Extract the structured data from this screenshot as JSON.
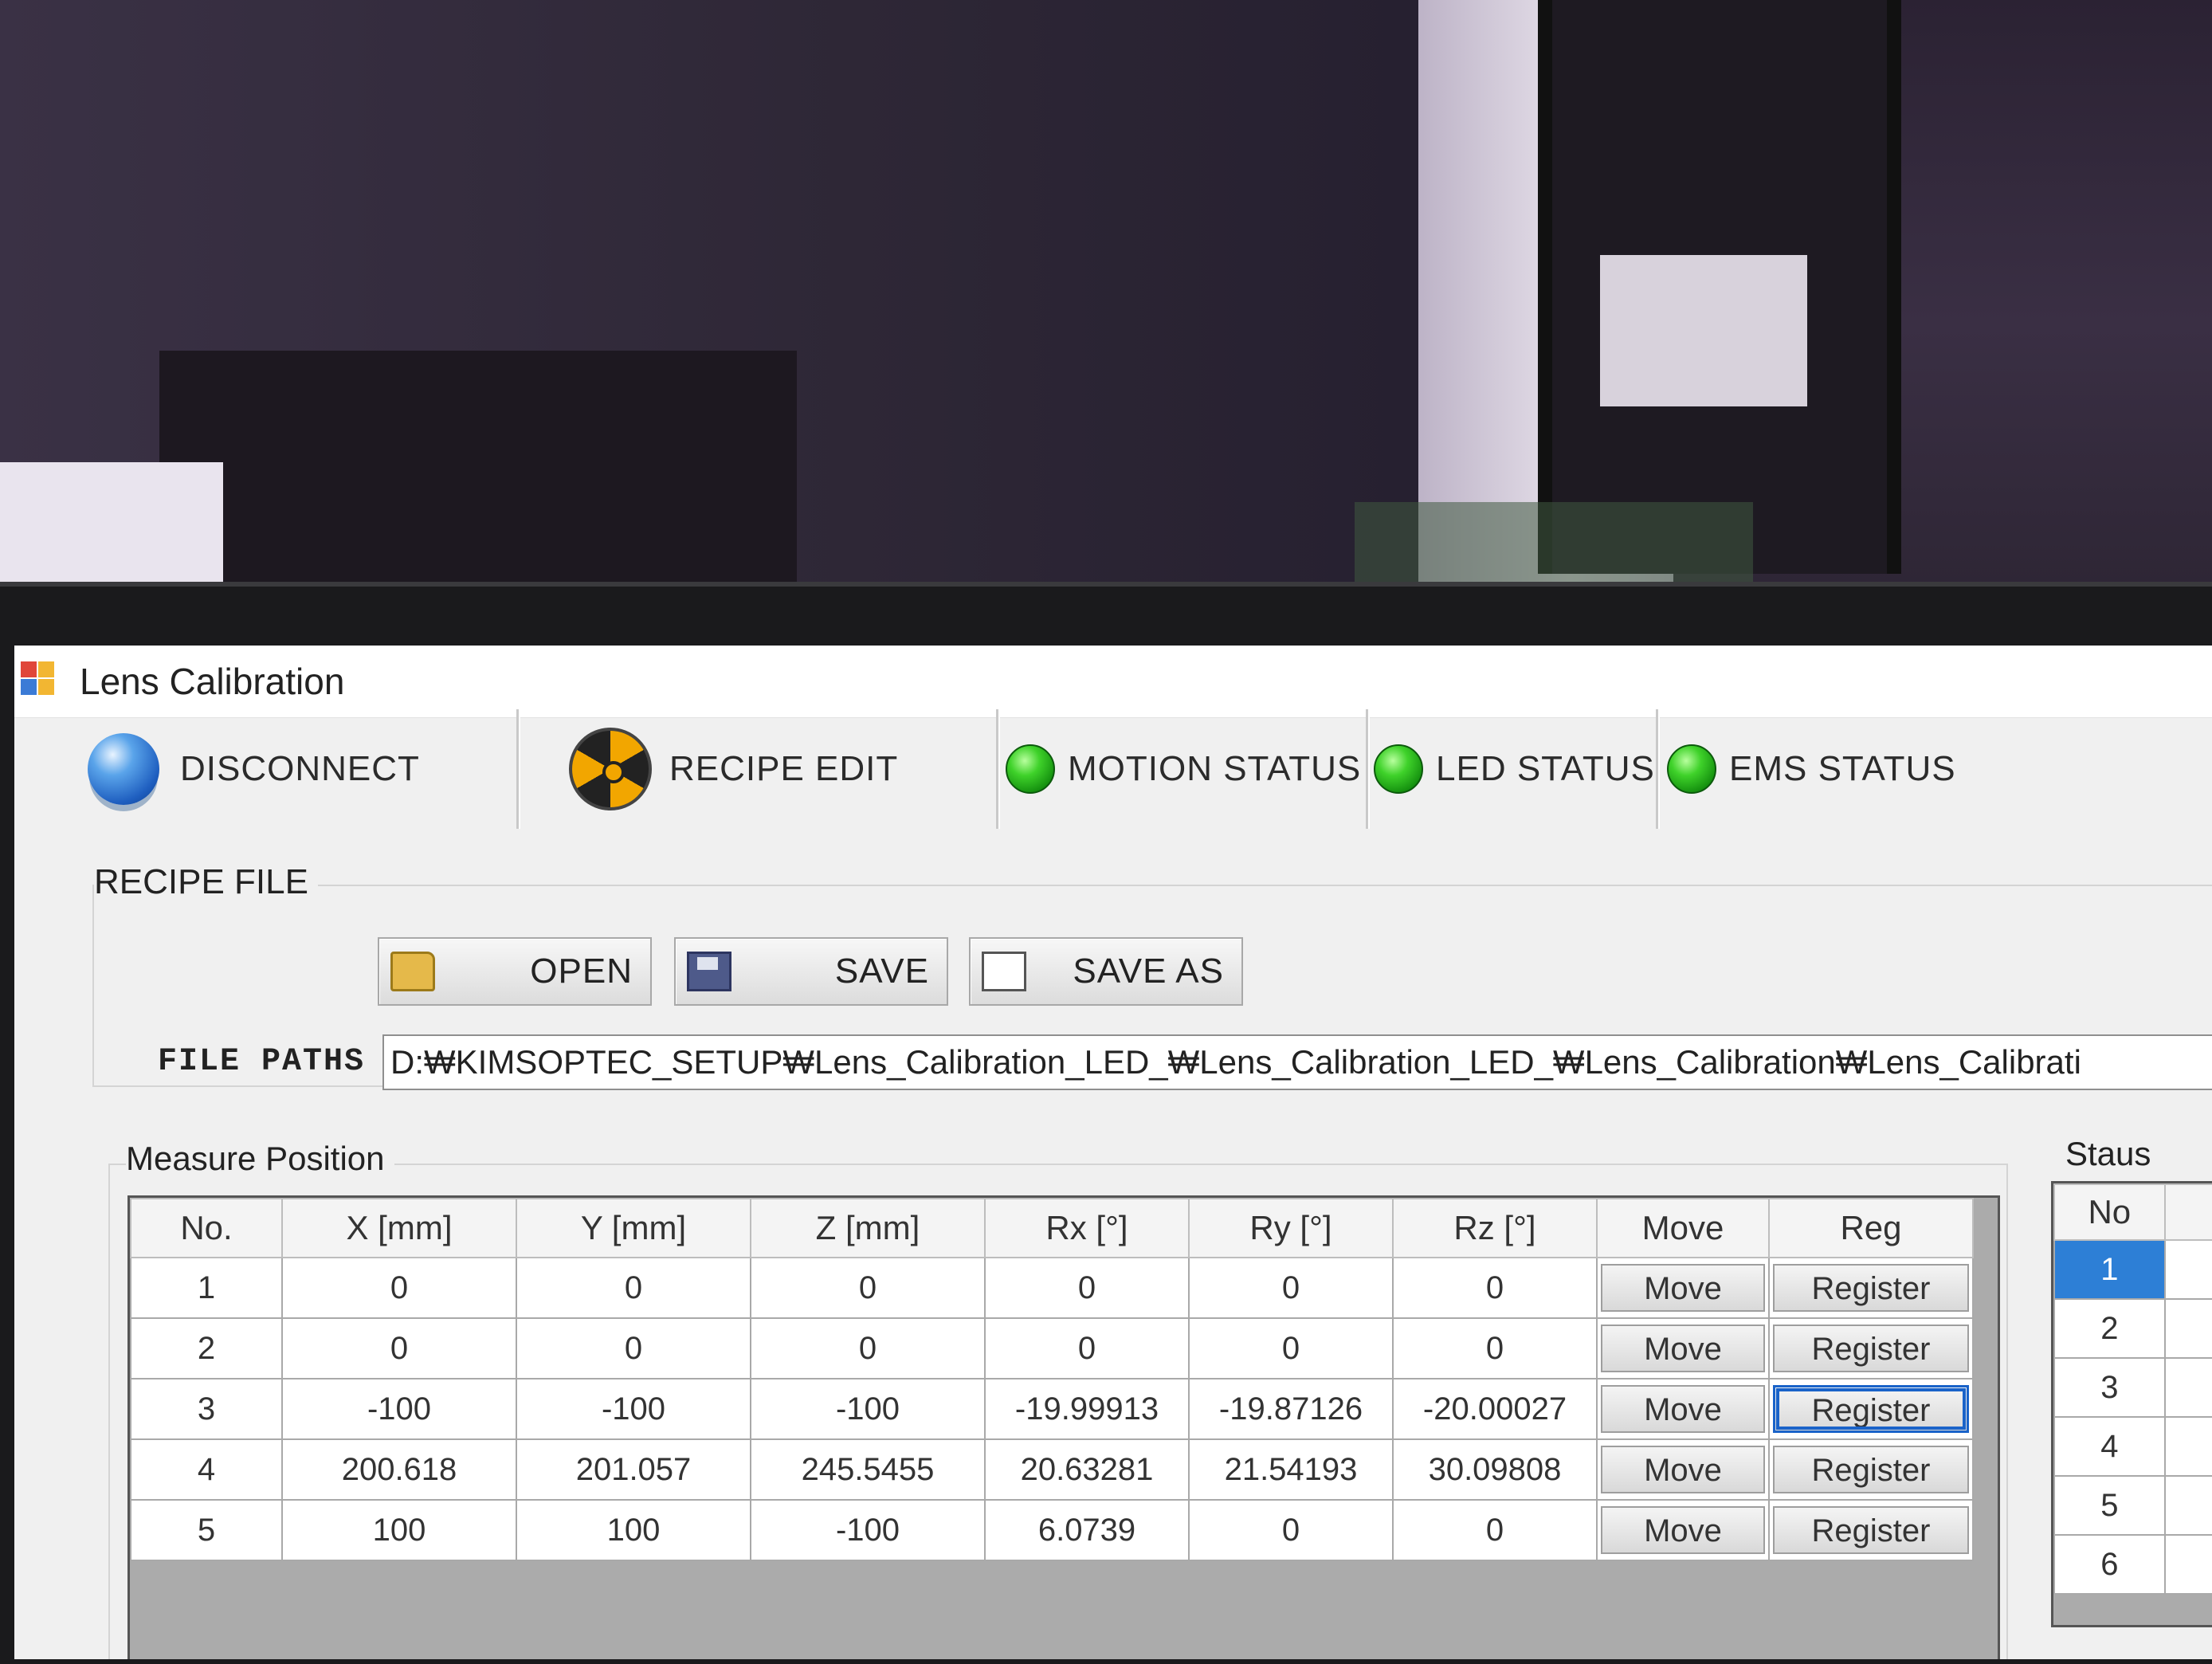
{
  "window": {
    "title": "Lens Calibration"
  },
  "toolbar": {
    "disconnect_label": "DISCONNECT",
    "recipe_edit_label": "RECIPE EDIT",
    "motion_status_label": "MOTION STATUS",
    "led_status_label": "LED STATUS",
    "ems_status_label": "EMS STATUS",
    "status_color": "#2fc21f"
  },
  "recipe_file": {
    "group_label": "RECIPE FILE",
    "open_label": "OPEN",
    "save_label": "SAVE",
    "save_as_label": "SAVE AS",
    "file_paths_label": "FILE PATHS",
    "file_path_value": "D:₩KIMSOPTEC_SETUP₩Lens_Calibration_LED_₩Lens_Calibration_LED_₩Lens_Calibration₩Lens_Calibrati"
  },
  "measure_position": {
    "group_label": "Measure Position",
    "columns": [
      "No.",
      "X [mm]",
      "Y [mm]",
      "Z [mm]",
      "Rx [°]",
      "Ry [°]",
      "Rz [°]",
      "Move",
      "Reg"
    ],
    "rows": [
      {
        "no": "1",
        "x": "0",
        "y": "0",
        "z": "0",
        "rx": "0",
        "ry": "0",
        "rz": "0",
        "move": "Move",
        "reg": "Register"
      },
      {
        "no": "2",
        "x": "0",
        "y": "0",
        "z": "0",
        "rx": "0",
        "ry": "0",
        "rz": "0",
        "move": "Move",
        "reg": "Register"
      },
      {
        "no": "3",
        "x": "-100",
        "y": "-100",
        "z": "-100",
        "rx": "-19.99913",
        "ry": "-19.87126",
        "rz": "-20.00027",
        "move": "Move",
        "reg": "Register"
      },
      {
        "no": "4",
        "x": "200.618",
        "y": "201.057",
        "z": "245.5455",
        "rx": "20.63281",
        "ry": "21.54193",
        "rz": "30.09808",
        "move": "Move",
        "reg": "Register"
      },
      {
        "no": "5",
        "x": "100",
        "y": "100",
        "z": "-100",
        "rx": "6.0739",
        "ry": "0",
        "rz": "0",
        "move": "Move",
        "reg": "Register"
      }
    ]
  },
  "status_panel": {
    "label": "Staus",
    "column": "No",
    "rows": [
      "1",
      "2",
      "3",
      "4",
      "5",
      "6"
    ],
    "selected": "1"
  }
}
